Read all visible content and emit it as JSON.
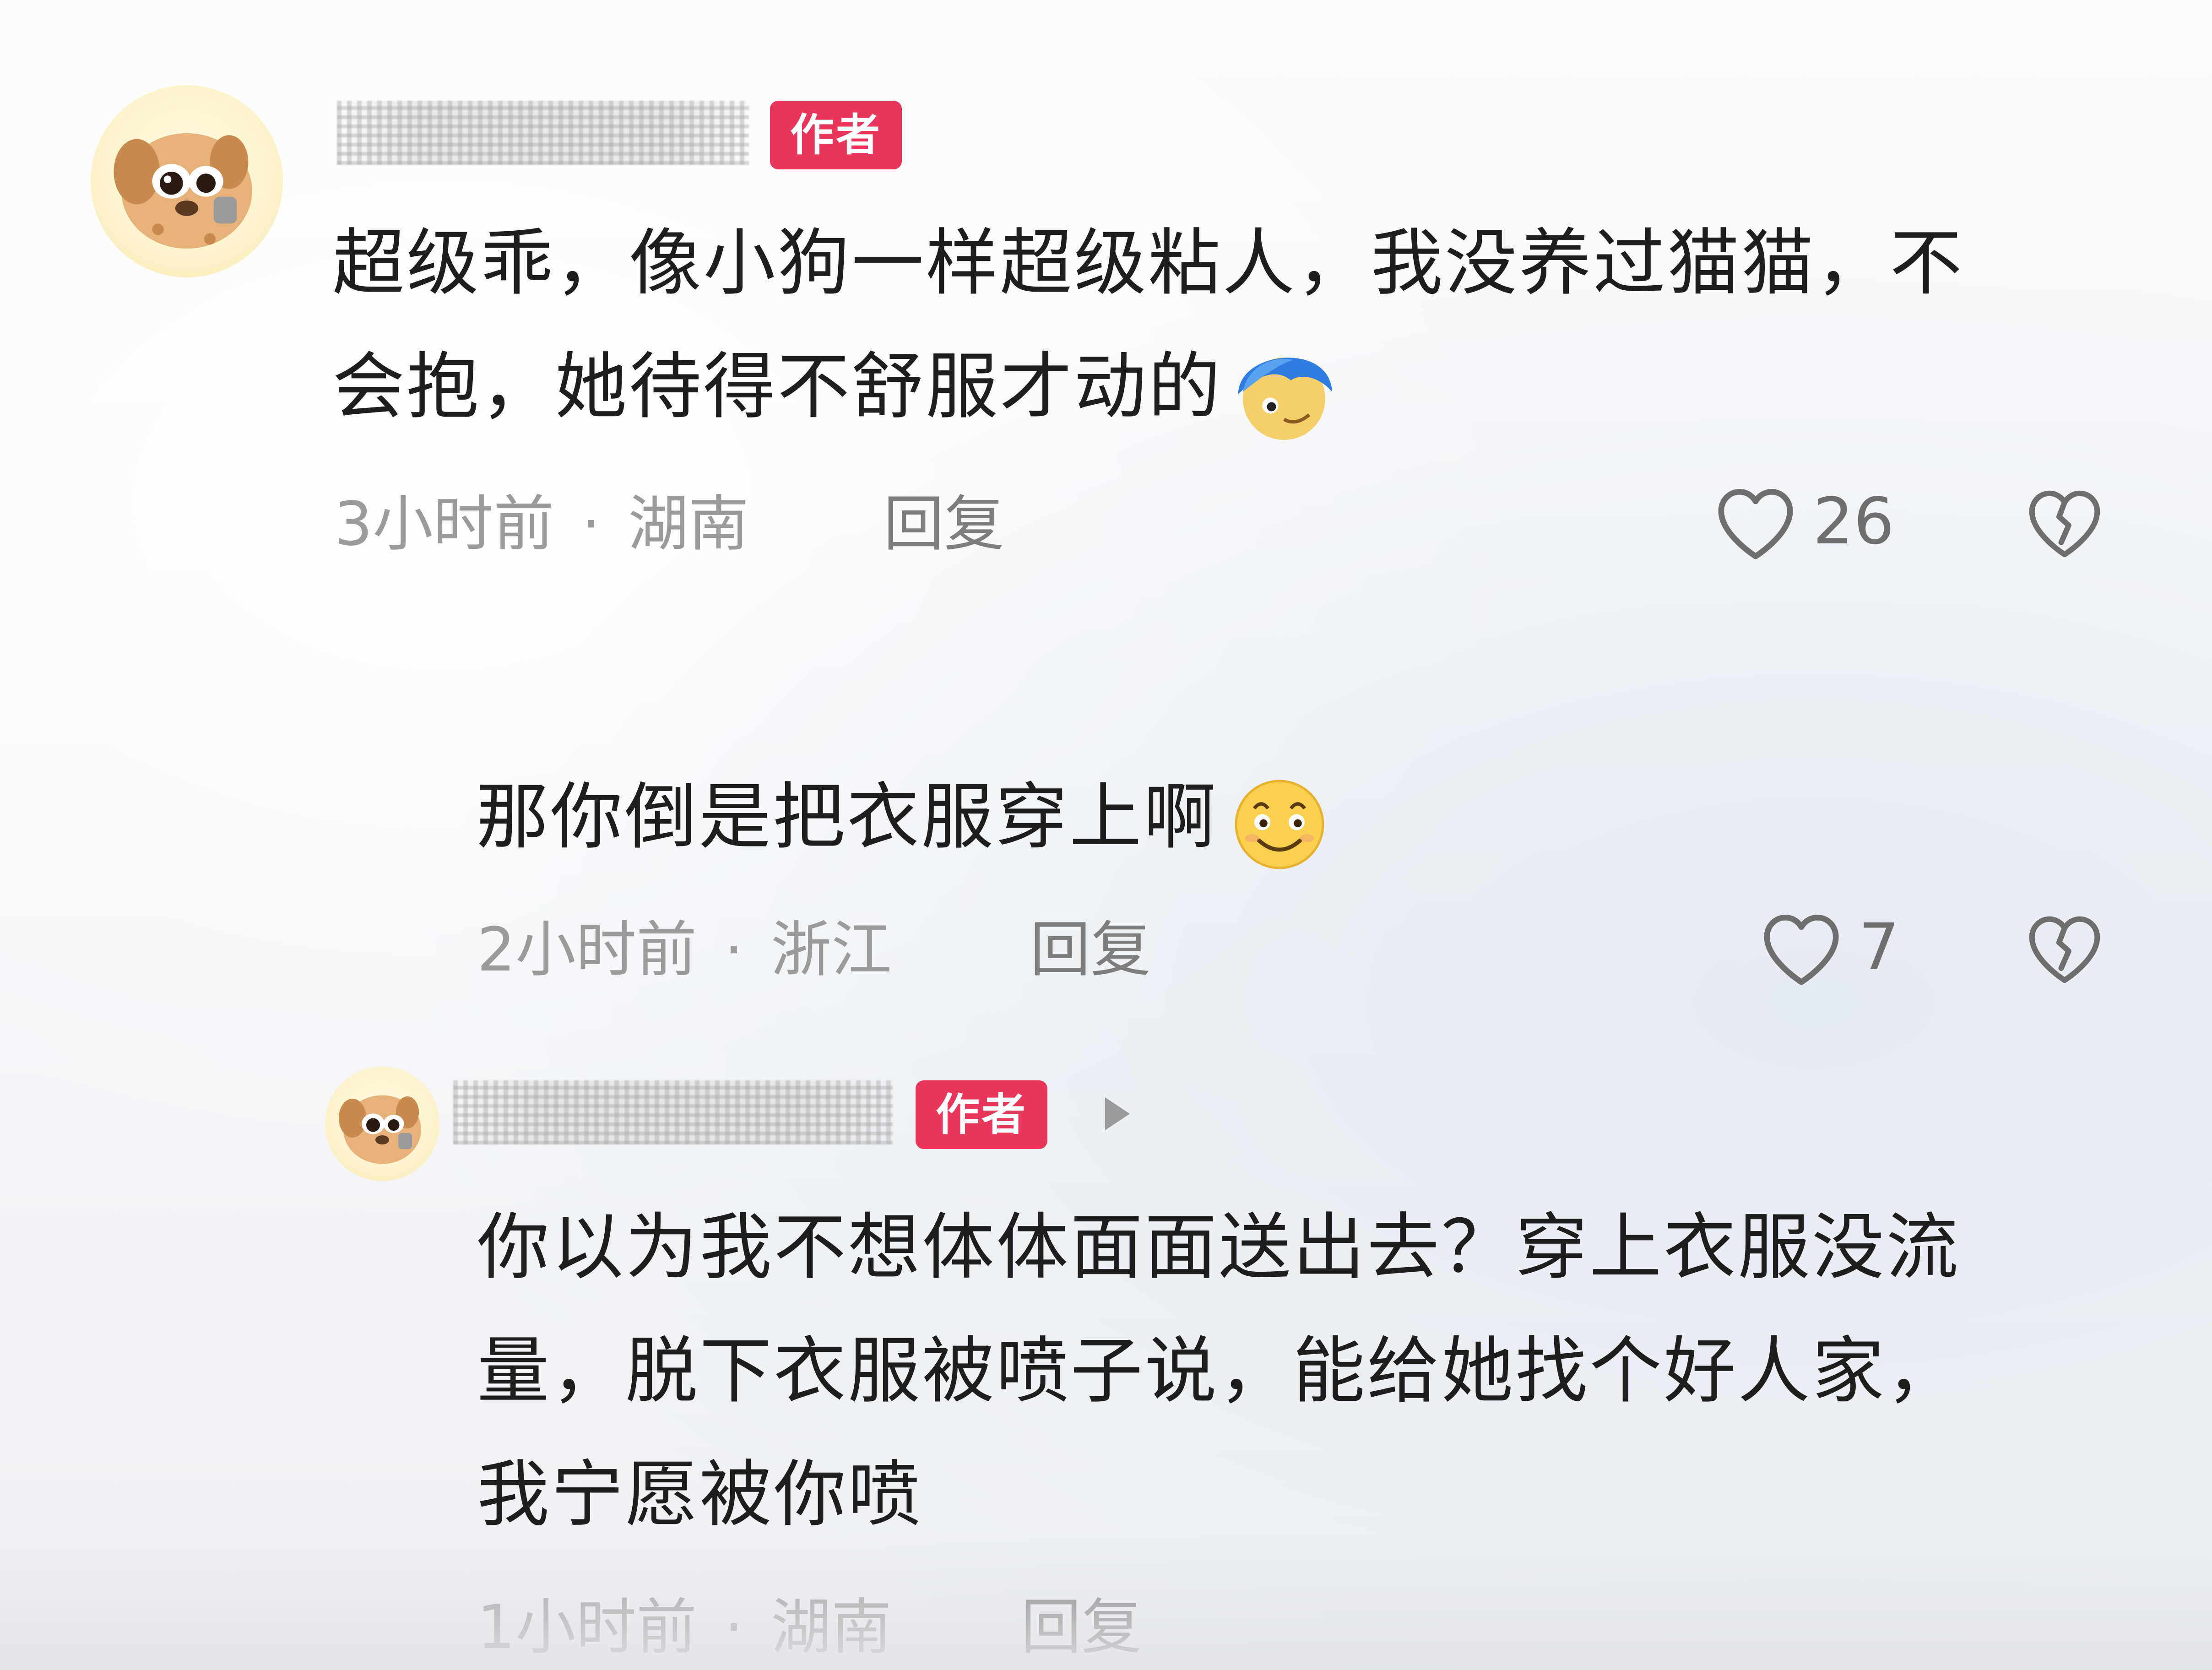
{
  "comments": [
    {
      "username": "██████████",
      "badge": "作者",
      "text_line1": "超级乖，像小狗一样超级粘人，我没养过猫猫，不",
      "text_line2": "会抱，她待得不舒服才动的",
      "emoji_icon": "blue-hair-face-emoji",
      "time": "3小时前",
      "separator": "·",
      "location": "湖南",
      "reply_label": "回复",
      "likes": "26"
    },
    {
      "text": "那你倒是把衣服穿上啊",
      "emoji_icon": "smiling-face-emoji",
      "time": "2小时前",
      "separator": "·",
      "location": "浙江",
      "reply_label": "回复",
      "likes": "7"
    },
    {
      "username": "██████████",
      "badge": "作者",
      "text_line1": "你以为我不想体体面面送出去？穿上衣服没流",
      "text_line2": "量，脱下衣服被喷子说，能给她找个好人家，",
      "text_line3": "我宁愿被你喷",
      "time": "1小时前",
      "separator": "·",
      "location": "湖南",
      "reply_label": "回复"
    }
  ],
  "colors": {
    "badge": "#e8375a",
    "meta_text": "#9b9b9b",
    "body_text": "#1e1e1e"
  }
}
